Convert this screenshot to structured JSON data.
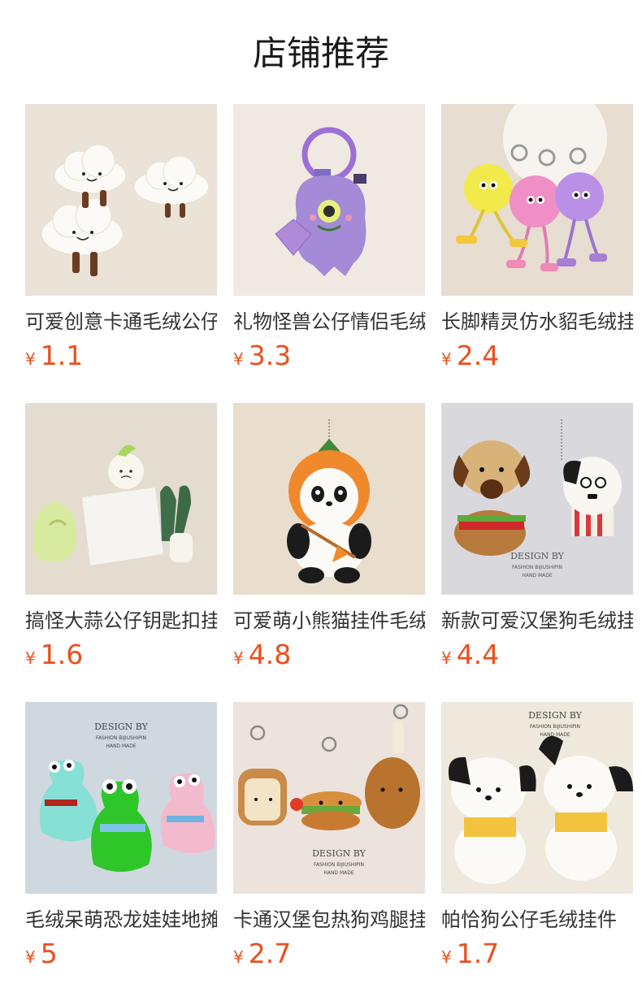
{
  "section_title": "店铺推荐",
  "currency_symbol": "¥",
  "products": [
    {
      "name": "可爱创意卡通毛绒公仔",
      "price": "1.1",
      "icon": "cloud-plush-image"
    },
    {
      "name": "礼物怪兽公仔情侣毛绒",
      "price": "3.3",
      "icon": "purple-monster-plush-image"
    },
    {
      "name": "长脚精灵仿水貂毛绒挂件",
      "price": "2.4",
      "icon": "fluffy-ball-sprite-image"
    },
    {
      "name": "搞怪大蒜公仔钥匙扣挂件",
      "price": "1.6",
      "icon": "garlic-vegetable-plush-image"
    },
    {
      "name": "可爱萌小熊猫挂件毛绒",
      "price": "4.8",
      "icon": "panda-plush-image"
    },
    {
      "name": "新款可爱汉堡狗毛绒挂件",
      "price": "4.4",
      "icon": "burger-dog-plush-image"
    },
    {
      "name": "毛绒呆萌恐龙娃娃地摊",
      "price": "5",
      "icon": "dinosaur-plush-image"
    },
    {
      "name": "卡通汉堡包热狗鸡腿挂件",
      "price": "2.7",
      "icon": "food-keychain-image"
    },
    {
      "name": "帕恰狗公仔毛绒挂件",
      "price": "1.7",
      "icon": "pochacco-plush-image"
    }
  ],
  "watermark": {
    "line1": "DESIGN BY",
    "line2": "FASHION BIJIUSHIPIN",
    "line3": "HAND MADE"
  }
}
